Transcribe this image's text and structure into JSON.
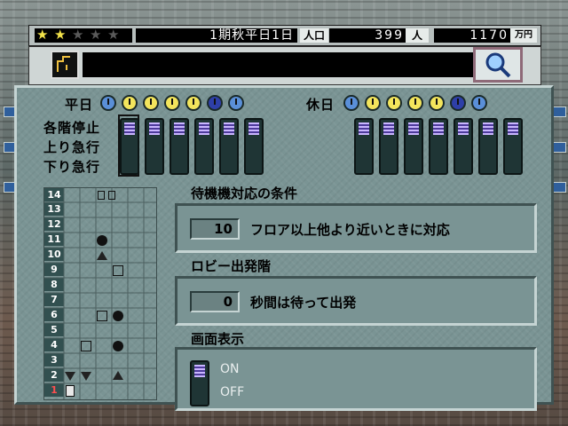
{
  "status_bar": {
    "rating_stars_filled": 2,
    "rating_stars_total": 5,
    "date": "1期秋平日1日",
    "population_label": "人口",
    "population_value": "399",
    "population_unit": "人",
    "funds_value": "1170",
    "funds_unit": "万円"
  },
  "toolbar": {
    "message": "",
    "left_icon": "elevator-route-icon",
    "right_icon": "magnifier-icon"
  },
  "schedule": {
    "weekday_label": "平日",
    "holiday_label": "休日",
    "modes": [
      "各階停止",
      "上り急行",
      "下り急行"
    ],
    "clock_icons_weekday": [
      "clock-icon",
      "clock-icon",
      "clock-icon",
      "clock-icon",
      "clock-icon",
      "clock-icon",
      "clock-icon"
    ],
    "clock_icons_holiday": [
      "clock-icon",
      "clock-icon",
      "clock-icon",
      "clock-icon",
      "clock-icon",
      "clock-icon",
      "clock-icon"
    ]
  },
  "floors": [
    "14",
    "13",
    "12",
    "11",
    "10",
    "9",
    "8",
    "7",
    "6",
    "5",
    "4",
    "3",
    "2",
    "1"
  ],
  "waiting": {
    "title": "待機機対応の条件",
    "value": "10",
    "text": "フロア以上他より近いときに対応"
  },
  "lobby": {
    "title": "ロビー出発階",
    "value": "0",
    "text": "秒間は待って出発"
  },
  "display": {
    "title": "画面表示",
    "on": "ON",
    "off": "OFF"
  },
  "colors": {
    "panel": "#7a9494",
    "star_filled": "#f2e24a",
    "star_empty": "#5a5a5a",
    "slider_knob": "#9a86ff"
  }
}
